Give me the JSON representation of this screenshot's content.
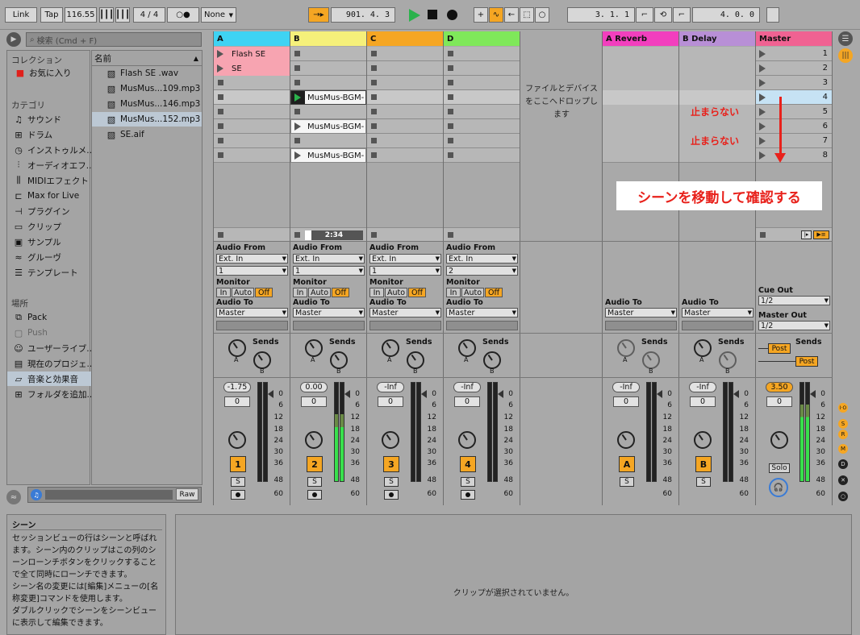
{
  "toolbar": {
    "link": "Link",
    "tap": "Tap",
    "tempo": "116.55",
    "sig": "4 / 4",
    "metro": "○●",
    "quant": "None",
    "pos": "901. 4. 3",
    "loop_start": "3. 1. 1",
    "loop_len": "4. 0. 0"
  },
  "browser": {
    "search_placeholder": "検索 (Cmd + F)",
    "collections_title": "コレクション",
    "favorites": "お気に入り",
    "category_title": "カテゴリ",
    "categories": [
      "サウンド",
      "ドラム",
      "インストゥルメ..",
      "オーディオエフ..",
      "MIDIエフェクト",
      "Max for Live",
      "プラグイン",
      "クリップ",
      "サンプル",
      "グルーヴ",
      "テンプレート"
    ],
    "places_title": "場所",
    "places": [
      "Pack",
      "Push",
      "ユーザーライブ..",
      "現在のプロジェ..",
      "音楽と効果音",
      "フォルダを追加.."
    ],
    "files_header": "名前",
    "files": [
      "Flash SE .wav",
      "MusMus...109.mp3",
      "MusMus...146.mp3",
      "MusMus...152.mp3",
      "SE.aif"
    ],
    "raw": "Raw"
  },
  "tracks": [
    {
      "name": "A",
      "color": "#3fd3f3",
      "clips": [
        "Flash SE",
        "SE"
      ],
      "vol": "-1.75",
      "pan": "0",
      "num": "1",
      "input_ch": "1"
    },
    {
      "name": "B",
      "color": "#f5f07a",
      "clip": "MusMus-BGM-",
      "time": "2:34",
      "vol": "0.00",
      "pan": "0",
      "num": "2",
      "input_ch": "1"
    },
    {
      "name": "C",
      "color": "#f5a623",
      "vol": "-Inf",
      "pan": "0",
      "num": "3",
      "input_ch": "1"
    },
    {
      "name": "D",
      "color": "#7fe85a",
      "vol": "-Inf",
      "pan": "0",
      "num": "4",
      "input_ch": "2"
    }
  ],
  "returns": [
    {
      "name": "A Reverb",
      "color": "#f23fbe",
      "vol": "-Inf",
      "pan": "0",
      "letter": "A"
    },
    {
      "name": "B Delay",
      "color": "#b88fd6",
      "vol": "-Inf",
      "pan": "0",
      "letter": "B"
    }
  ],
  "master": {
    "name": "Master",
    "color": "#f06292",
    "scenes": [
      "1",
      "2",
      "3",
      "4",
      "5",
      "6",
      "7",
      "8"
    ],
    "vol": "3.50",
    "pan": "0",
    "cue_out_label": "Cue Out",
    "cue_out": "1/2",
    "master_out_label": "Master Out",
    "master_out": "1/2",
    "solo": "Solo",
    "post": "Post"
  },
  "io": {
    "audio_from": "Audio From",
    "ext_in": "Ext. In",
    "monitor": "Monitor",
    "in": "In",
    "auto": "Auto",
    "off": "Off",
    "audio_to": "Audio To",
    "master": "Master",
    "sends": "Sends"
  },
  "dropzone": "ファイルとデバイスをここへドロップします",
  "annotations": {
    "no_stop1": "止まらない",
    "no_stop2": "止まらない",
    "move_scene": "シーンを移動して確認する"
  },
  "info": {
    "title": "シーン",
    "body": "セッションビューの行はシーンと呼ばれます。シーン内のクリップはこの列のシーンローンチボタンをクリックすることで全て同時にローンチできます。\nシーン名の変更には[編集]メニューの[名称変更]コマンドを使用します。\nダブルクリックでシーンをシーンビューに表示して編集できます。"
  },
  "detail": {
    "empty": "クリップが選択されていません。"
  },
  "scale": [
    "0",
    "6",
    "12",
    "18",
    "24",
    "30",
    "36",
    "48",
    "60"
  ]
}
